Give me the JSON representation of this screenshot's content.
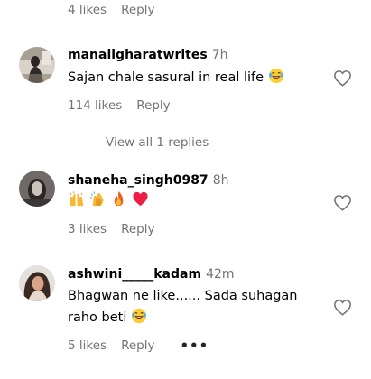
{
  "top_actions": {
    "likes": "4 likes",
    "reply": "Reply"
  },
  "comments": [
    {
      "username": "manaligharatwrites",
      "time": "7h",
      "text": "Sajan chale sasural in real life",
      "likes": "114 likes",
      "reply": "Reply"
    },
    {
      "username": "shaneha_singh0987",
      "time": "8h",
      "text": "",
      "likes": "3 likes",
      "reply": "Reply"
    },
    {
      "username": "ashwini_____kadam",
      "time": "42m",
      "text_line1": "Bhagwan ne like...... Sada suhagan",
      "text_line2": "raho beti",
      "likes": "5 likes",
      "reply": "Reply"
    }
  ],
  "view_replies": "View all 1 replies",
  "colors": {
    "muted": "#737373",
    "text": "#000000",
    "divider": "#dbdbdb"
  },
  "icons": [
    "heart-outline-icon",
    "laughing-tears-emoji",
    "raised-hands-emoji",
    "clapping-hands-emoji",
    "fire-emoji",
    "red-heart-emoji",
    "more-options-icon"
  ]
}
